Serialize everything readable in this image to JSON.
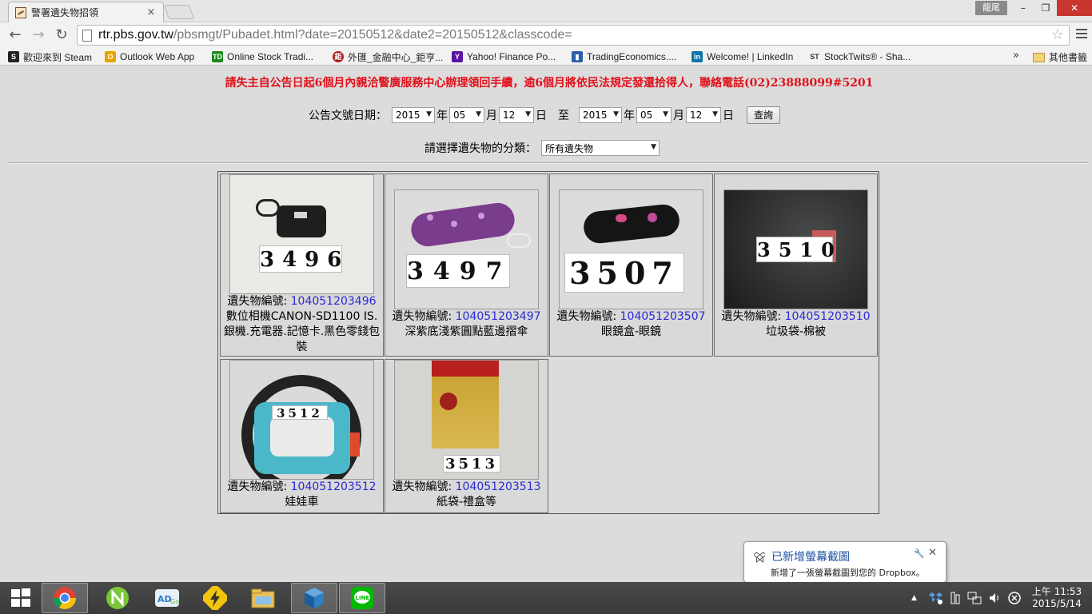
{
  "browser": {
    "tab_title": "警署遺失物招領",
    "tab_close": "×",
    "user_badge": "龍尾",
    "win_min": "–",
    "win_max": "❐",
    "win_close": "✕",
    "back_glyph": "←",
    "fwd_glyph": "→",
    "reload_glyph": "↻",
    "url_host": "rtr.pbs.gov.tw",
    "url_path": "/pbsmgt/Pubadet.html?date=20150512&date2=20150512&classcode=",
    "star_glyph": "☆"
  },
  "bookmarks": {
    "items": [
      {
        "label": "歡迎來到 Steam",
        "icon": "steam-icon",
        "color": "#222222"
      },
      {
        "label": "Outlook Web App",
        "icon": "outlook-icon",
        "color": "#e8a200"
      },
      {
        "label": "Online Stock Tradi...",
        "icon": "td-icon",
        "color": "#1a8a1a"
      },
      {
        "label": "外匯_金融中心_鉅亨...",
        "icon": "cnyes-icon",
        "color": "#b02020"
      },
      {
        "label": "Yahoo! Finance Po...",
        "icon": "yahoo-icon",
        "color": "#5c14a0"
      },
      {
        "label": "TradingEconomics....",
        "icon": "tradingeconomics-icon",
        "color": "#2c5fa8"
      },
      {
        "label": "Welcome! | LinkedIn",
        "icon": "linkedin-icon",
        "color": "#0e76a8"
      },
      {
        "label": "StockTwits® - Sha...",
        "icon": "stocktwits-icon",
        "color": "#333333"
      }
    ],
    "more": "»",
    "other_folder": "其他書籤"
  },
  "page": {
    "notice": "請失主自公告日起6個月內親洽警廣服務中心辦理領回手續，逾6個月將依民法規定發還拾得人，聯絡電話(02)23888099#5201",
    "date_label": "公告文號日期：",
    "from": {
      "year": "2015",
      "month": "05",
      "day": "12"
    },
    "to": {
      "year": "2015",
      "month": "05",
      "day": "12"
    },
    "unit_year": "年",
    "unit_month": "月",
    "unit_day": "日",
    "to_word": "至",
    "query_button": "查詢",
    "category_label": "請選擇遺失物的分類：",
    "category_value": "所有遺失物"
  },
  "items": [
    {
      "prefix": "遺失物編號: ",
      "id": "104051203496",
      "desc": "數位相機CANON-SD1100 IS.銀機.充電器.記憶卡.黑色零錢包裝",
      "tag": "3496"
    },
    {
      "prefix": "遺失物編號: ",
      "id": "104051203497",
      "desc": "深紫底淺紫圓點藍邊摺傘",
      "tag": "3497"
    },
    {
      "prefix": "遺失物編號: ",
      "id": "104051203507",
      "desc": "眼鏡盒-眼鏡",
      "tag": "3507"
    },
    {
      "prefix": "遺失物編號: ",
      "id": "104051203510",
      "desc": "垃圾袋-棉被",
      "tag": "3510"
    },
    {
      "prefix": "遺失物編號: ",
      "id": "104051203512",
      "desc": "娃娃車",
      "tag": "3512"
    },
    {
      "prefix": "遺失物編號: ",
      "id": "104051203513",
      "desc": "紙袋-禮盒等",
      "tag": "3513"
    }
  ],
  "toast": {
    "title": "已新增螢幕截圖",
    "body": "新增了一張螢幕截圖到您的 Dropbox。",
    "pin": "🔧",
    "close": "✕"
  },
  "taskbar": {
    "apps": [
      "chrome-icon",
      "n-app-icon",
      "adgo-icon",
      "lightning-app-icon",
      "file-explorer-icon",
      "virtualbox-icon",
      "line-icon"
    ],
    "clock_time": "上午 11:53",
    "clock_date": "2015/5/14",
    "tray_arrow": "▲"
  }
}
